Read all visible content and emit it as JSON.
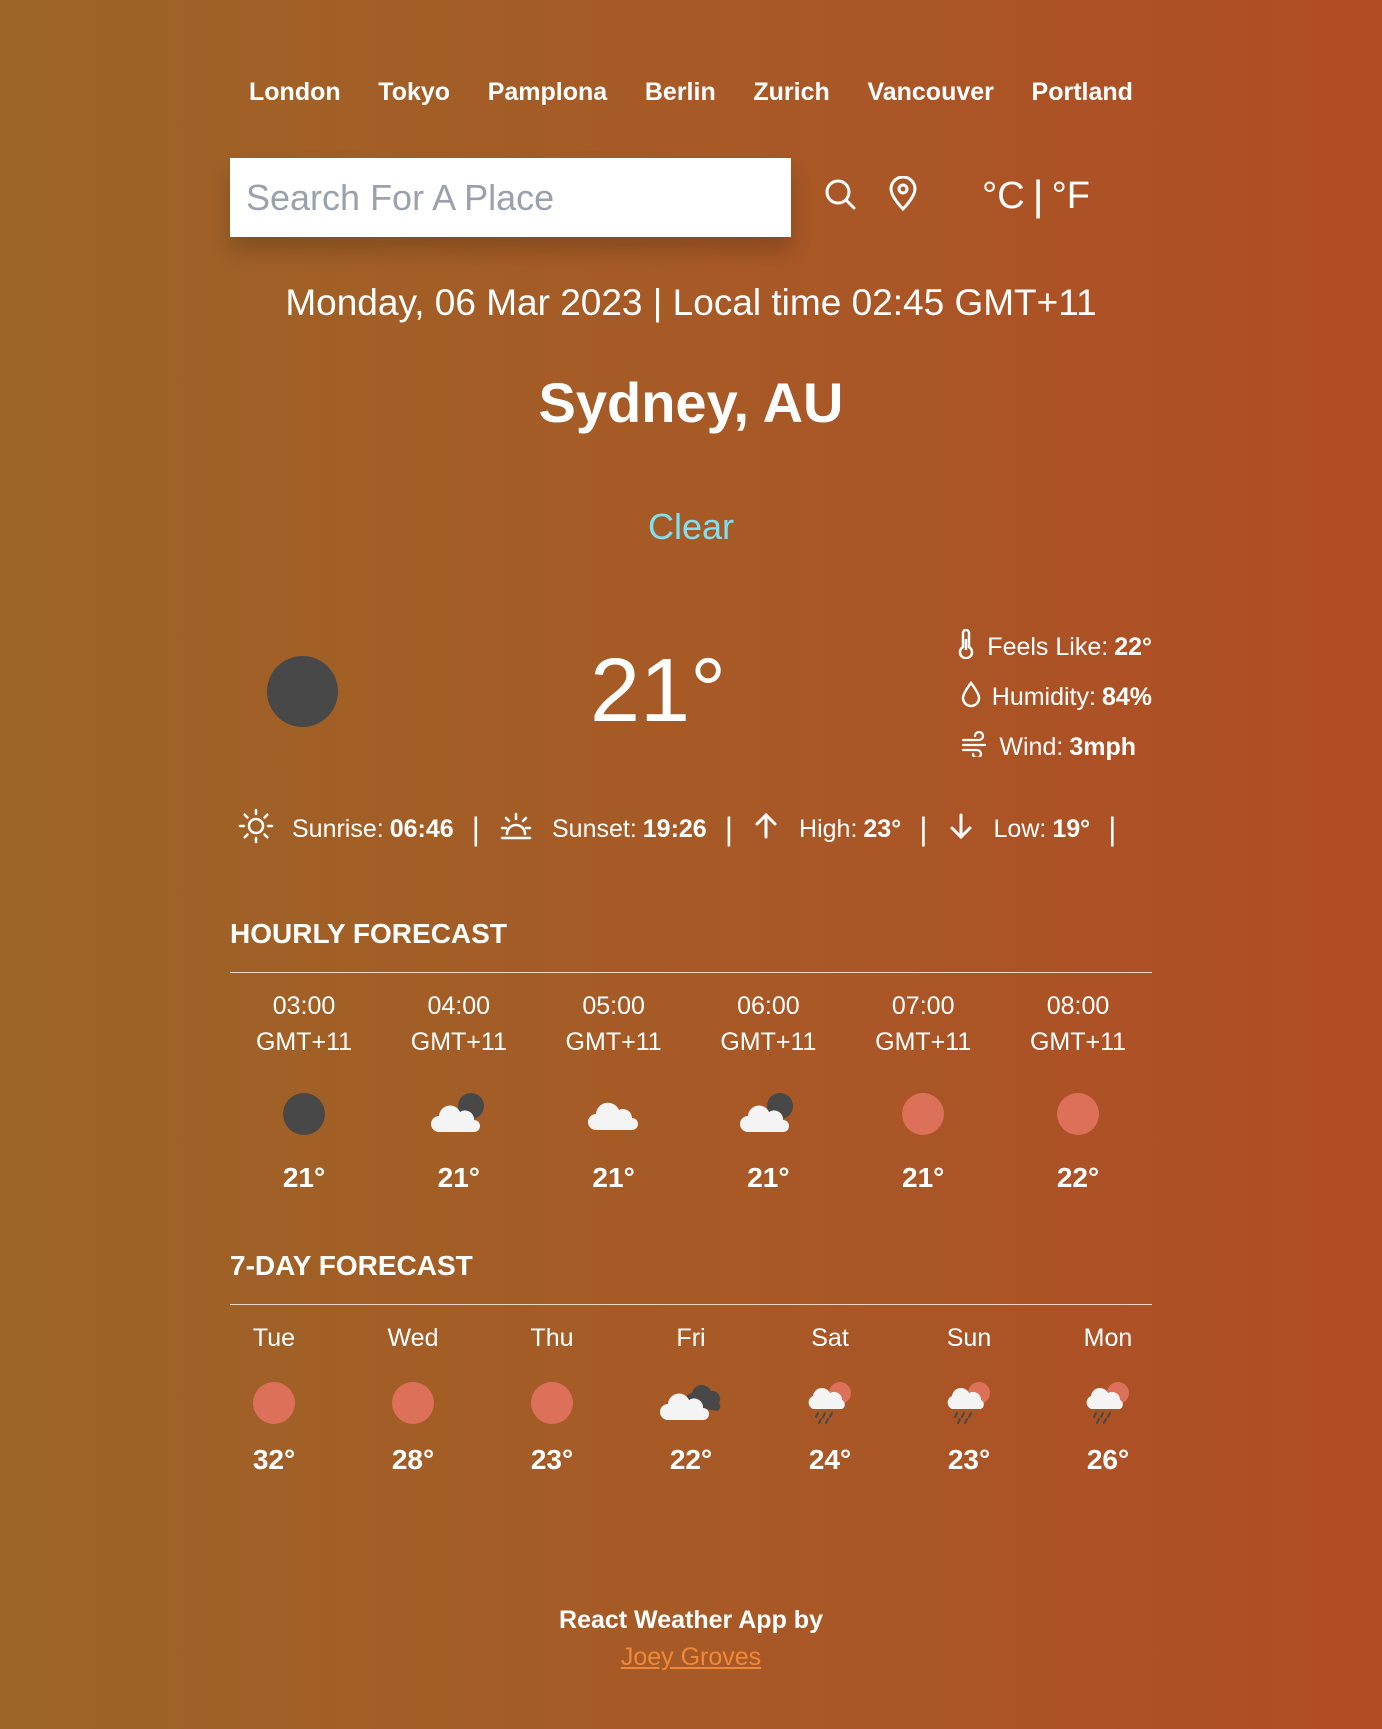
{
  "cities": [
    "London",
    "Tokyo",
    "Pamplona",
    "Berlin",
    "Zurich",
    "Vancouver",
    "Portland"
  ],
  "search": {
    "placeholder": "Search For A Place",
    "value": ""
  },
  "units": {
    "celsius": "°C",
    "separator": "|",
    "fahrenheit": "°F"
  },
  "date_line": "Monday, 06 Mar 2023 | Local time 02:45 GMT+11",
  "location": "Sydney, AU",
  "condition": "Clear",
  "current": {
    "icon": "moon-icon",
    "temp": "21°",
    "feels_like_label": "Feels Like:",
    "feels_like": "22°",
    "humidity_label": "Humidity:",
    "humidity": "84%",
    "wind_label": "Wind:",
    "wind": "3mph"
  },
  "sun": {
    "sunrise_label": "Sunrise:",
    "sunrise": "06:46",
    "sunset_label": "Sunset:",
    "sunset": "19:26",
    "high_label": "High:",
    "high": "23°",
    "low_label": "Low:",
    "low": "19°",
    "separator": "|"
  },
  "hourly_title": "HOURLY FORECAST",
  "hourly": [
    {
      "time": "03:00",
      "zone": "GMT+11",
      "icon": "moon-icon",
      "temp": "21°"
    },
    {
      "time": "04:00",
      "zone": "GMT+11",
      "icon": "cloud-moon-icon",
      "temp": "21°"
    },
    {
      "time": "05:00",
      "zone": "GMT+11",
      "icon": "cloud-icon",
      "temp": "21°"
    },
    {
      "time": "06:00",
      "zone": "GMT+11",
      "icon": "cloud-moon-icon",
      "temp": "21°"
    },
    {
      "time": "07:00",
      "zone": "GMT+11",
      "icon": "sun-icon",
      "temp": "21°"
    },
    {
      "time": "08:00",
      "zone": "GMT+11",
      "icon": "sun-icon",
      "temp": "22°"
    }
  ],
  "daily_title": "7-DAY FORECAST",
  "daily": [
    {
      "day": "Tue",
      "icon": "sun-icon",
      "temp": "32°"
    },
    {
      "day": "Wed",
      "icon": "sun-icon",
      "temp": "28°"
    },
    {
      "day": "Thu",
      "icon": "sun-icon",
      "temp": "23°"
    },
    {
      "day": "Fri",
      "icon": "dark-clouds-icon",
      "temp": "22°"
    },
    {
      "day": "Sat",
      "icon": "rain-sun-icon",
      "temp": "24°"
    },
    {
      "day": "Sun",
      "icon": "rain-sun-icon",
      "temp": "23°"
    },
    {
      "day": "Mon",
      "icon": "rain-sun-icon",
      "temp": "26°"
    }
  ],
  "footer": {
    "text": "React Weather App by",
    "author": "Joey Groves"
  },
  "colors": {
    "accent_condition": "#7ee0f0",
    "sun": "#dc7058",
    "moon": "#484848",
    "link": "#f0883a"
  }
}
